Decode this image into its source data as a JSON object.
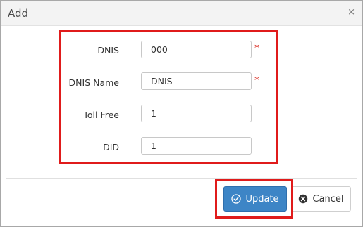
{
  "dialog": {
    "title": "Add",
    "close_glyph": "×"
  },
  "form": {
    "fields": [
      {
        "label": "DNIS",
        "value": "000",
        "required": true
      },
      {
        "label": "DNIS Name",
        "value": "DNIS",
        "required": true
      },
      {
        "label": "Toll Free",
        "value": "1",
        "required": false
      },
      {
        "label": "DID",
        "value": "1",
        "required": false
      }
    ],
    "required_mark": "*"
  },
  "footer": {
    "update_label": "Update",
    "cancel_label": "Cancel",
    "update_icon": "check-circle-icon",
    "cancel_icon": "times-circle-icon"
  },
  "colors": {
    "highlight": "#e01b1b",
    "primary_button": "#3d85c6",
    "required": "#d9261c"
  }
}
